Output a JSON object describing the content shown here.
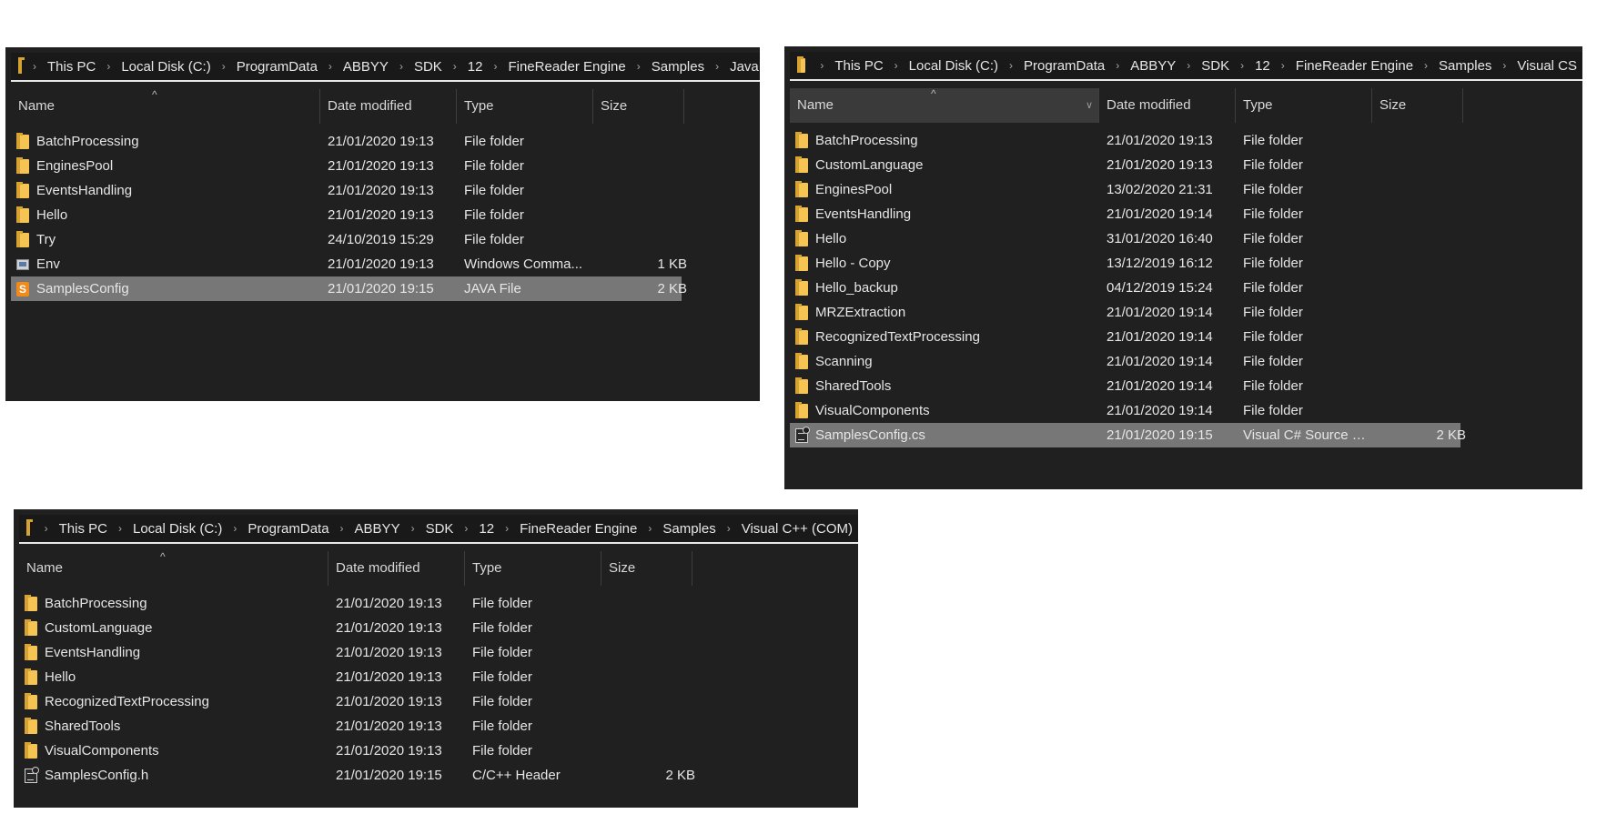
{
  "columns": {
    "name": "Name",
    "date": "Date modified",
    "type": "Type",
    "size": "Size"
  },
  "windows": [
    {
      "breadcrumb": [
        "This PC",
        "Local Disk (C:)",
        "ProgramData",
        "ABBYY",
        "SDK",
        "12",
        "FineReader Engine",
        "Samples",
        "Java"
      ],
      "items": [
        {
          "name": "BatchProcessing",
          "date": "21/01/2020 19:13",
          "type": "File folder",
          "size": "",
          "icon": "folder-icon"
        },
        {
          "name": "EnginesPool",
          "date": "21/01/2020 19:13",
          "type": "File folder",
          "size": "",
          "icon": "folder-icon"
        },
        {
          "name": "EventsHandling",
          "date": "21/01/2020 19:13",
          "type": "File folder",
          "size": "",
          "icon": "folder-icon"
        },
        {
          "name": "Hello",
          "date": "21/01/2020 19:13",
          "type": "File folder",
          "size": "",
          "icon": "folder-icon"
        },
        {
          "name": "Try",
          "date": "24/10/2019 15:29",
          "type": "File folder",
          "size": "",
          "icon": "folder-icon"
        },
        {
          "name": "Env",
          "date": "21/01/2020 19:13",
          "type": "Windows Comma...",
          "size": "1 KB",
          "icon": "cmd-icon"
        },
        {
          "name": "SamplesConfig",
          "date": "21/01/2020 19:15",
          "type": "JAVA File",
          "size": "2 KB",
          "icon": "java-file-icon",
          "selected": true
        }
      ]
    },
    {
      "breadcrumb": [
        "This PC",
        "Local Disk (C:)",
        "ProgramData",
        "ABBYY",
        "SDK",
        "12",
        "FineReader Engine",
        "Samples",
        "Visual CS"
      ],
      "items": [
        {
          "name": "BatchProcessing",
          "date": "21/01/2020 19:13",
          "type": "File folder",
          "size": "",
          "icon": "folder-icon"
        },
        {
          "name": "CustomLanguage",
          "date": "21/01/2020 19:13",
          "type": "File folder",
          "size": "",
          "icon": "folder-icon"
        },
        {
          "name": "EnginesPool",
          "date": "13/02/2020 21:31",
          "type": "File folder",
          "size": "",
          "icon": "folder-icon"
        },
        {
          "name": "EventsHandling",
          "date": "21/01/2020 19:14",
          "type": "File folder",
          "size": "",
          "icon": "folder-icon"
        },
        {
          "name": "Hello",
          "date": "31/01/2020 16:40",
          "type": "File folder",
          "size": "",
          "icon": "folder-icon"
        },
        {
          "name": "Hello - Copy",
          "date": "13/12/2019 16:12",
          "type": "File folder",
          "size": "",
          "icon": "folder-icon"
        },
        {
          "name": "Hello_backup",
          "date": "04/12/2019 15:24",
          "type": "File folder",
          "size": "",
          "icon": "folder-icon"
        },
        {
          "name": "MRZExtraction",
          "date": "21/01/2020 19:14",
          "type": "File folder",
          "size": "",
          "icon": "folder-icon"
        },
        {
          "name": "RecognizedTextProcessing",
          "date": "21/01/2020 19:14",
          "type": "File folder",
          "size": "",
          "icon": "folder-icon"
        },
        {
          "name": "Scanning",
          "date": "21/01/2020 19:14",
          "type": "File folder",
          "size": "",
          "icon": "folder-icon"
        },
        {
          "name": "SharedTools",
          "date": "21/01/2020 19:14",
          "type": "File folder",
          "size": "",
          "icon": "folder-icon"
        },
        {
          "name": "VisualComponents",
          "date": "21/01/2020 19:14",
          "type": "File folder",
          "size": "",
          "icon": "folder-icon"
        },
        {
          "name": "SamplesConfig.cs",
          "date": "21/01/2020 19:15",
          "type": "Visual C# Source F...",
          "size": "2 KB",
          "icon": "source-file-icon",
          "selected": true
        }
      ]
    },
    {
      "breadcrumb": [
        "This PC",
        "Local Disk (C:)",
        "ProgramData",
        "ABBYY",
        "SDK",
        "12",
        "FineReader Engine",
        "Samples",
        "Visual C++ (COM)"
      ],
      "items": [
        {
          "name": "BatchProcessing",
          "date": "21/01/2020 19:13",
          "type": "File folder",
          "size": "",
          "icon": "folder-icon"
        },
        {
          "name": "CustomLanguage",
          "date": "21/01/2020 19:13",
          "type": "File folder",
          "size": "",
          "icon": "folder-icon"
        },
        {
          "name": "EventsHandling",
          "date": "21/01/2020 19:13",
          "type": "File folder",
          "size": "",
          "icon": "folder-icon"
        },
        {
          "name": "Hello",
          "date": "21/01/2020 19:13",
          "type": "File folder",
          "size": "",
          "icon": "folder-icon"
        },
        {
          "name": "RecognizedTextProcessing",
          "date": "21/01/2020 19:13",
          "type": "File folder",
          "size": "",
          "icon": "folder-icon"
        },
        {
          "name": "SharedTools",
          "date": "21/01/2020 19:13",
          "type": "File folder",
          "size": "",
          "icon": "folder-icon"
        },
        {
          "name": "VisualComponents",
          "date": "21/01/2020 19:13",
          "type": "File folder",
          "size": "",
          "icon": "folder-icon"
        },
        {
          "name": "SamplesConfig.h",
          "date": "21/01/2020 19:15",
          "type": "C/C++ Header",
          "size": "2 KB",
          "icon": "source-file-icon"
        }
      ]
    }
  ]
}
